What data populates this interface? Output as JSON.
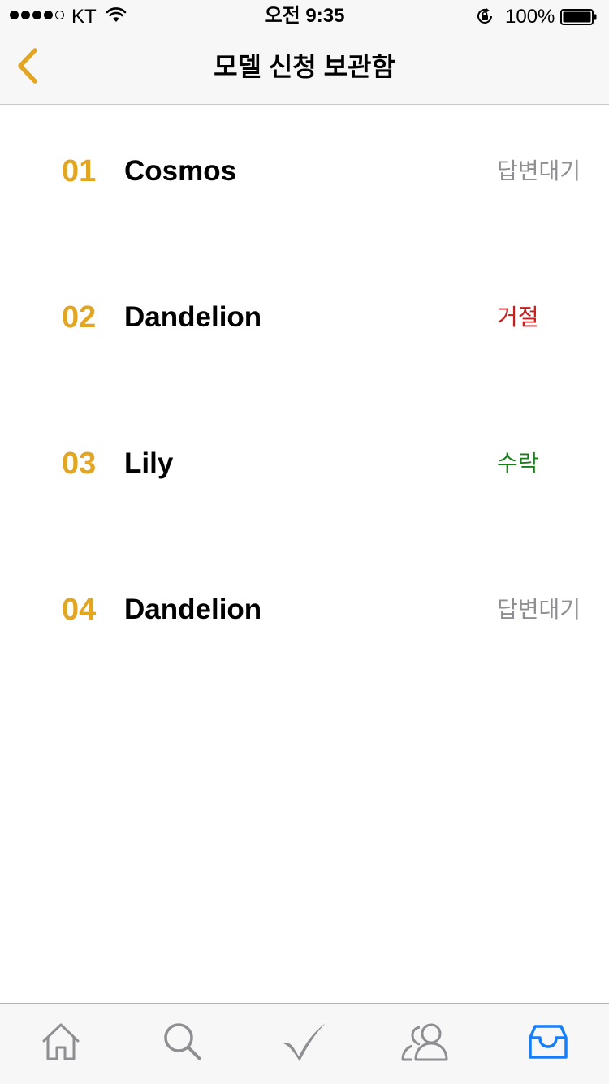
{
  "status_bar": {
    "carrier": "KT",
    "time": "오전 9:35",
    "battery": "100%",
    "signal_icon": "signal-dots-icon",
    "wifi_icon": "wifi-icon",
    "rotation_lock_icon": "rotation-lock-icon",
    "battery_icon": "battery-icon"
  },
  "nav": {
    "title": "모델 신청 보관함",
    "back_icon": "chevron-left-icon"
  },
  "colors": {
    "accent": "#e2a623",
    "pending": "#8e8e93",
    "rejected": "#c81e1e",
    "accepted": "#1a7f1a",
    "tab_active": "#157efb",
    "tab_inactive": "#8e8e93"
  },
  "requests": [
    {
      "number": "01",
      "name": "Cosmos",
      "status": "답변대기",
      "status_color": "#8e8e93"
    },
    {
      "number": "02",
      "name": "Dandelion",
      "status": "거절",
      "status_color": "#c81e1e"
    },
    {
      "number": "03",
      "name": "Lily",
      "status": "수락",
      "status_color": "#1a7f1a"
    },
    {
      "number": "04",
      "name": "Dandelion",
      "status": "답변대기",
      "status_color": "#8e8e93"
    }
  ],
  "tabbar": {
    "items": [
      {
        "icon": "home-icon",
        "active": false
      },
      {
        "icon": "search-icon",
        "active": false
      },
      {
        "icon": "checkmark-icon",
        "active": false
      },
      {
        "icon": "people-icon",
        "active": false
      },
      {
        "icon": "inbox-icon",
        "active": true
      }
    ]
  }
}
